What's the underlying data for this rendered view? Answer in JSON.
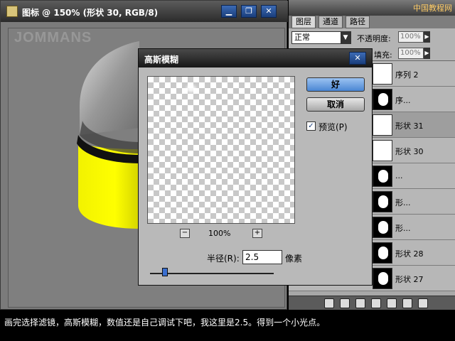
{
  "document": {
    "title": "图标 @ 150% (形状 30, RGB/8)",
    "watermark": "JOMMANS",
    "buttons": [
      "▁",
      "❐",
      "✕"
    ]
  },
  "layers_panel": {
    "signature": "中国教程网",
    "tabs": [
      "图层",
      "通道",
      "路径"
    ],
    "blend_mode": "正常",
    "opacity_label": "不透明度:",
    "opacity_value": "100%",
    "fill_label": "填充:",
    "fill_value": "100%",
    "layers": [
      {
        "name": "序列 2",
        "thumb": "white"
      },
      {
        "name": "序...",
        "thumb": "mask"
      },
      {
        "name": "形状 31",
        "thumb": "white",
        "selected": true
      },
      {
        "name": "形状 30",
        "thumb": "white"
      },
      {
        "name": "...",
        "thumb": "mask"
      },
      {
        "name": "形...",
        "thumb": "mask"
      },
      {
        "name": "形...",
        "thumb": "mask"
      },
      {
        "name": "形状 28",
        "thumb": "mask"
      },
      {
        "name": "形状 27",
        "thumb": "mask"
      }
    ]
  },
  "dialog": {
    "title": "高斯模糊",
    "ok_label": "好",
    "cancel_label": "取消",
    "preview_label": "预览(P)",
    "preview_checked": true,
    "zoom_value": "100%",
    "zoom_minus": "−",
    "zoom_plus": "+",
    "radius_label": "半径(R):",
    "radius_value": "2.5",
    "radius_unit": "像素",
    "slider_fraction": 0.12
  },
  "caption": "画完选择滤镜，高斯模糊，数值还是自己调试下吧，我这里是2.5。得到一个小光点。",
  "colors": {
    "accent_blue": "#3c6bb5",
    "yellow": "#ffff00"
  }
}
